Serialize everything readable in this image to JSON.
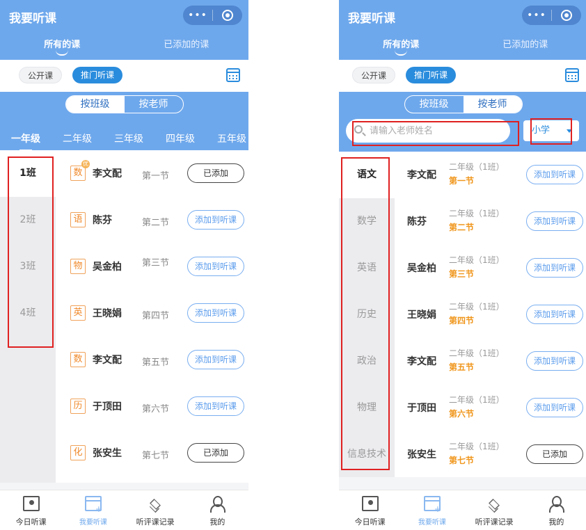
{
  "colors": {
    "brand": "#6ea8ec",
    "accent": "#2a8cdd",
    "subject_orange": "#f08a2c",
    "annotation_red": "#e02020"
  },
  "app": {
    "title": "我要听课",
    "capsule_more": "•••",
    "capsule_icon": "target-icon"
  },
  "tabs": [
    "所有的课",
    "已添加的课"
  ],
  "type_filter": {
    "public": "公开课",
    "open_door": "推门听课",
    "calendar_icon": "calendar-icon"
  },
  "segment": [
    "按班级",
    "按老师"
  ],
  "left": {
    "grades": [
      "一年级",
      "二年级",
      "三年级",
      "四年级",
      "五年级"
    ],
    "classes": [
      "1班",
      "2班",
      "3班",
      "4班"
    ],
    "lessons": [
      {
        "subject": "数",
        "teacher": "李文配",
        "period": "第一节",
        "action": "已添加",
        "added": true,
        "badge": "优"
      },
      {
        "subject": "语",
        "teacher": "陈芬",
        "period": "第二节",
        "action": "添加到听课",
        "added": false
      },
      {
        "subject": "物",
        "teacher": "吴金柏",
        "period": "第三节",
        "action": "添加到听课",
        "added": false
      },
      {
        "subject": "英",
        "teacher": "王晓娟",
        "period": "第四节",
        "action": "添加到听课",
        "added": false
      },
      {
        "subject": "数",
        "teacher": "李文配",
        "period": "第五节",
        "action": "添加到听课",
        "added": false
      },
      {
        "subject": "历",
        "teacher": "于顶田",
        "period": "第六节",
        "action": "添加到听课",
        "added": false
      },
      {
        "subject": "化",
        "teacher": "张安生",
        "period": "第七节",
        "action": "已添加",
        "added": true
      }
    ]
  },
  "right": {
    "search": {
      "placeholder": "请输入老师姓名",
      "value": ""
    },
    "school_stage": "小学",
    "subjects": [
      "语文",
      "数学",
      "英语",
      "历史",
      "政治",
      "物理",
      "信息技术"
    ],
    "lessons": [
      {
        "teacher": "李文配",
        "grade": "二年级（1班）",
        "period": "第一节",
        "action": "添加到听课",
        "added": false
      },
      {
        "teacher": "陈芬",
        "grade": "二年级（1班）",
        "period": "第二节",
        "action": "添加到听课",
        "added": false
      },
      {
        "teacher": "吴金柏",
        "grade": "二年级（1班）",
        "period": "第三节",
        "action": "添加到听课",
        "added": false
      },
      {
        "teacher": "王晓娟",
        "grade": "二年级（1班）",
        "period": "第四节",
        "action": "添加到听课",
        "added": false
      },
      {
        "teacher": "李文配",
        "grade": "二年级（1班）",
        "period": "第五节",
        "action": "添加到听课",
        "added": false
      },
      {
        "teacher": "于顶田",
        "grade": "二年级（1班）",
        "period": "第六节",
        "action": "添加到听课",
        "added": false
      },
      {
        "teacher": "张安生",
        "grade": "二年级（1班）",
        "period": "第七节",
        "action": "已添加",
        "added": true
      }
    ]
  },
  "nav": [
    {
      "label": "今日听课",
      "icon": "monitor-icon"
    },
    {
      "label": "我要听课",
      "icon": "calendar-add-icon"
    },
    {
      "label": "听评课记录",
      "icon": "layers-icon"
    },
    {
      "label": "我的",
      "icon": "user-icon"
    }
  ]
}
